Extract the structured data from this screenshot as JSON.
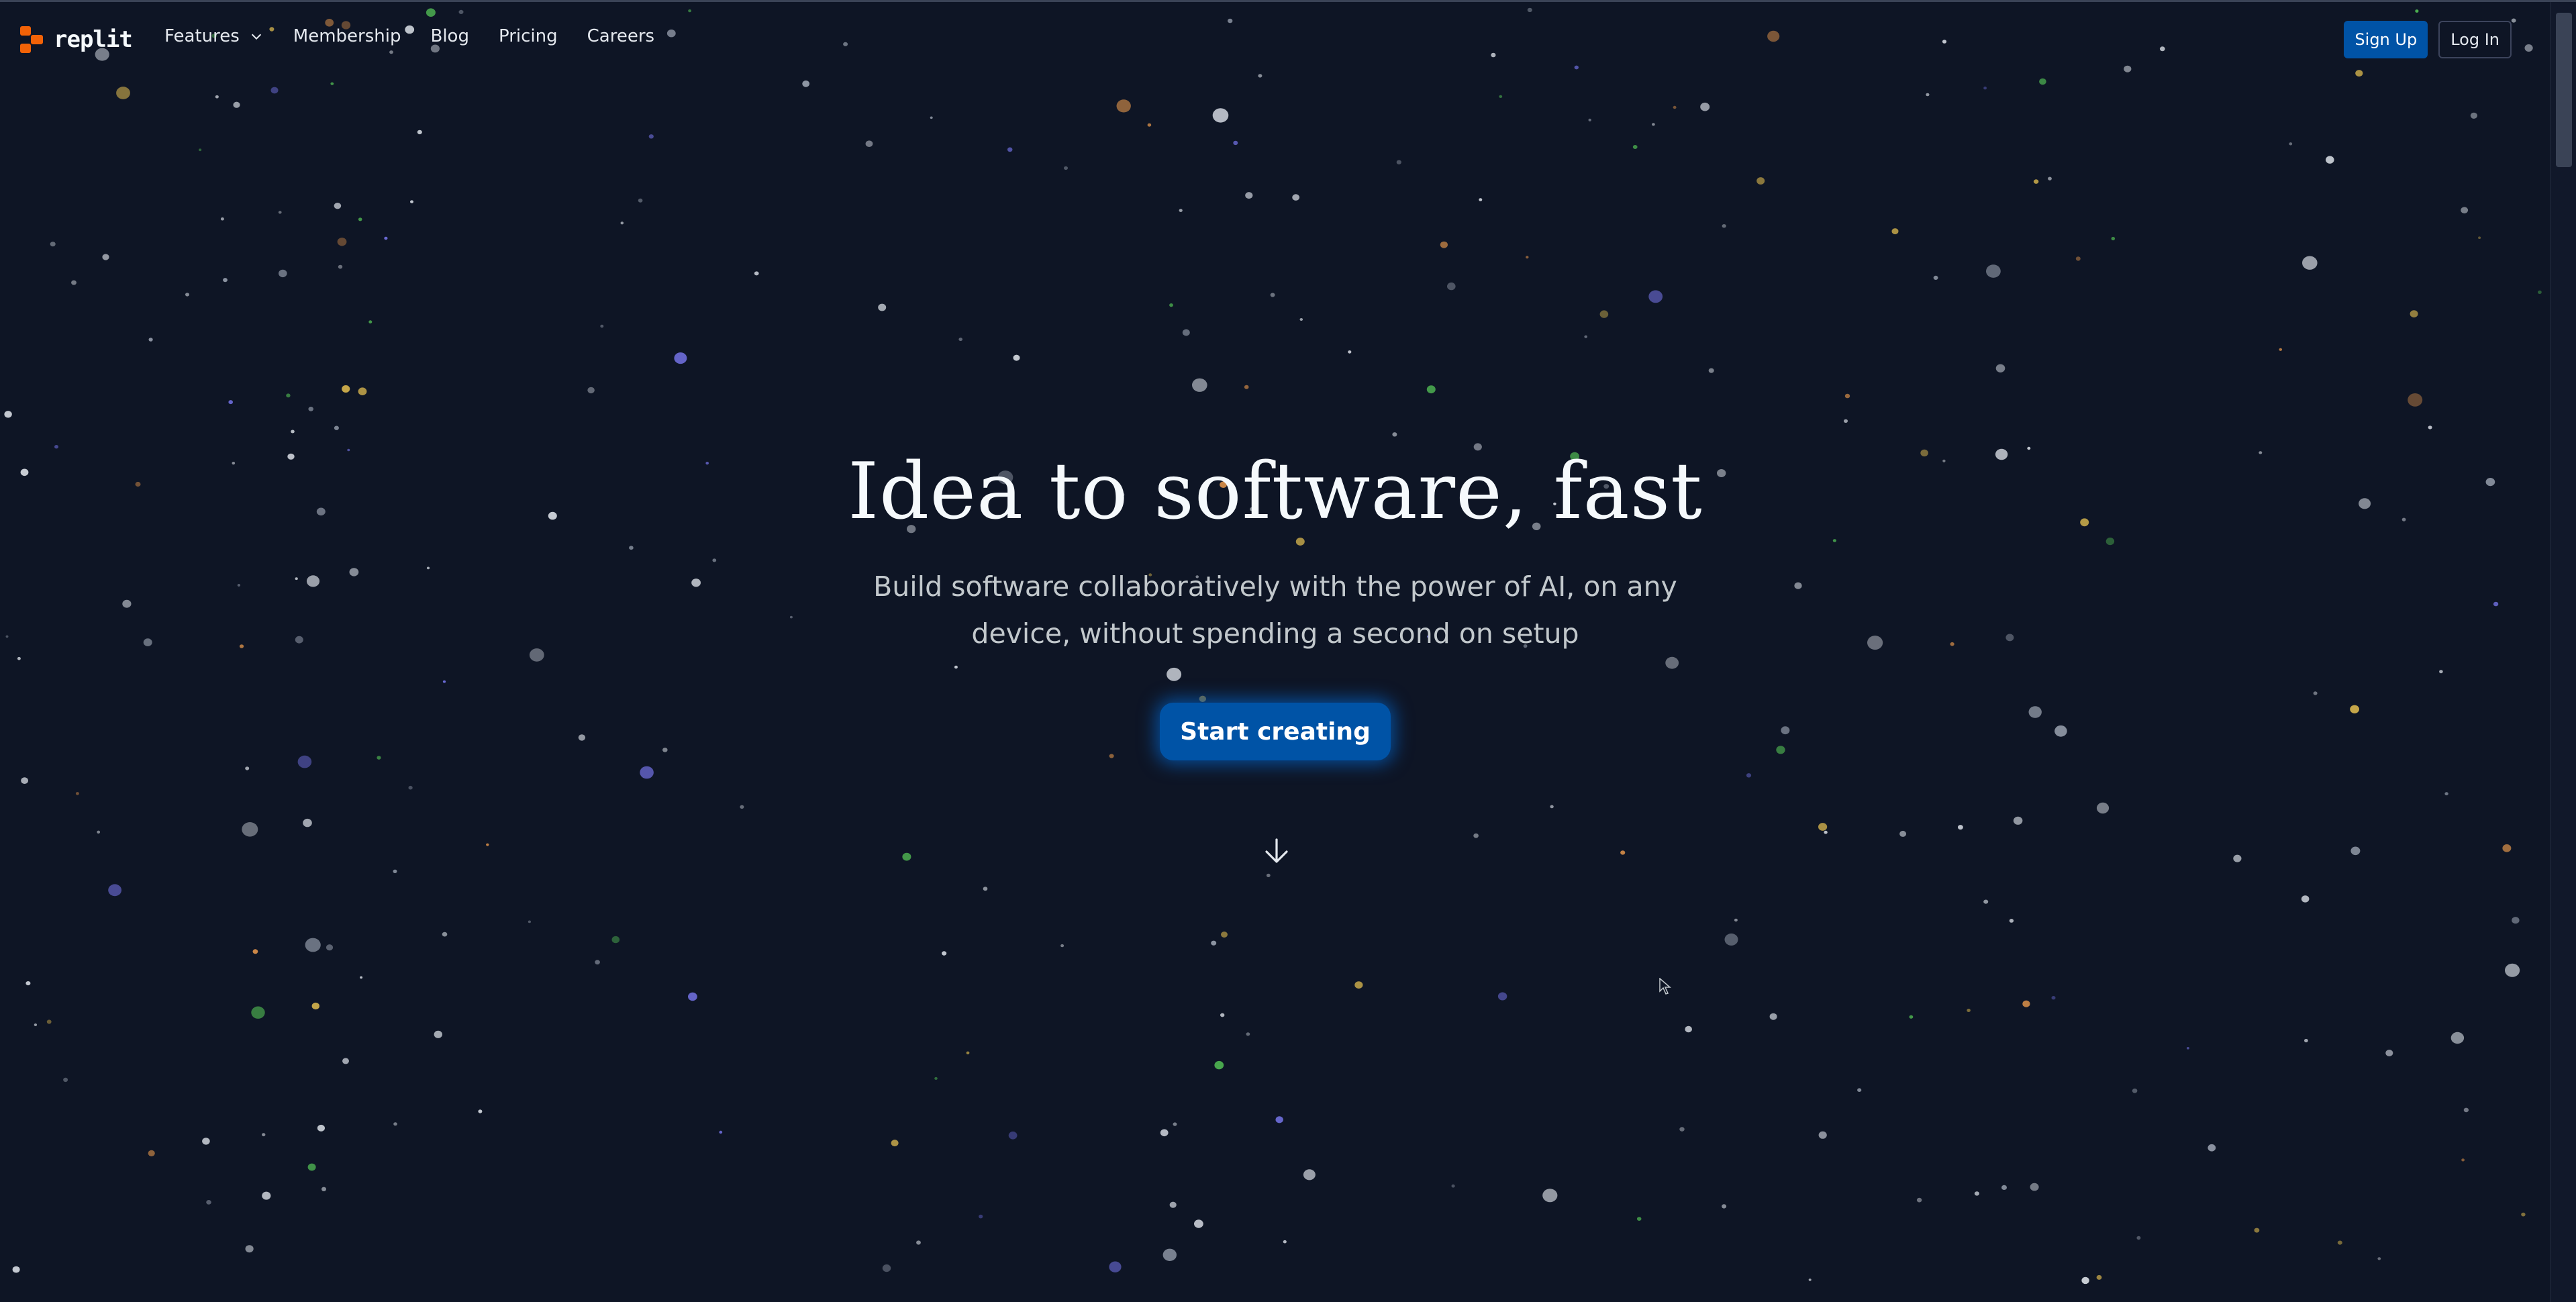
{
  "brand": {
    "name": "replit",
    "accent": "#f26207"
  },
  "colors": {
    "background": "#0e1525",
    "primary_button": "#0053a6"
  },
  "nav": {
    "features": "Features",
    "features_icon": "chevron-down-icon",
    "membership": "Membership",
    "blog": "Blog",
    "pricing": "Pricing",
    "careers": "Careers",
    "sign_up": "Sign Up",
    "log_in": "Log In"
  },
  "hero": {
    "title": "Idea to software, fast",
    "subtitle": "Build software collaboratively with the power of AI, on any device, without spending a second on setup",
    "cta": "Start creating",
    "scroll_icon": "arrow-down-icon"
  }
}
